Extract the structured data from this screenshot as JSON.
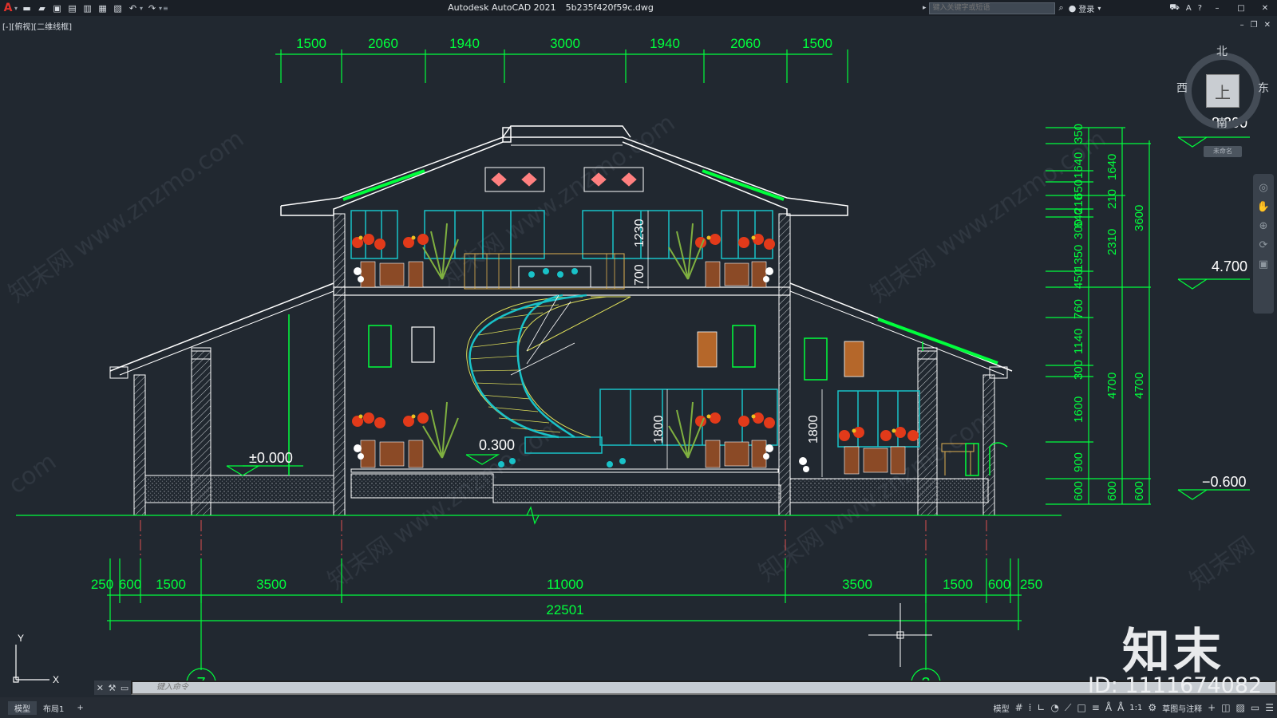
{
  "app": {
    "title": "Autodesk AutoCAD 2021",
    "filename": "5b235f420f59c.dwg",
    "search_placeholder": "键入关键字或短语",
    "login_label": "登录"
  },
  "viewport": {
    "label": "[-][俯视][二维线框]"
  },
  "viewcube": {
    "north": "北",
    "south": "南",
    "east": "东",
    "west": "西",
    "face": "上",
    "unnamed": "未命名"
  },
  "dims": {
    "top": [
      "1500",
      "2060",
      "1940",
      "3000",
      "1940",
      "2060",
      "1500"
    ],
    "bottom": [
      "250",
      "600",
      "1500",
      "3500",
      "11000",
      "3500",
      "1500",
      "600",
      "250"
    ],
    "total": "22501",
    "right_inner": [
      "350",
      "1640",
      "650",
      "210",
      "640",
      "300",
      "1350",
      "450",
      "760",
      "1140",
      "300",
      "1600",
      "900",
      "600"
    ],
    "right_mid": [
      "1640",
      "210",
      "2310",
      "4700",
      "600"
    ],
    "right_outer": [
      "3600",
      "4700",
      "600"
    ],
    "levels": [
      "8.300",
      "4.700",
      "−0.600"
    ],
    "floor_labels": [
      "±0.000",
      "0.300"
    ],
    "vertical_labels": [
      "1230",
      "700",
      "1800",
      "1800"
    ]
  },
  "axes": {
    "left_bubble": "7",
    "right_bubble": "3"
  },
  "ucs": {
    "x": "X",
    "y": "Y"
  },
  "command": {
    "placeholder": "键入命令"
  },
  "status": {
    "tabs": [
      "模型",
      "布局1"
    ],
    "model_label": "模型",
    "scale": "1:1",
    "workspace": "草图与注释"
  },
  "watermark": {
    "logo": "知末",
    "id": "ID: 1111674082"
  },
  "colors": {
    "bg": "#212830",
    "dim": "#00ff3c",
    "wall": "#ffffff",
    "glass": "#19c2c8",
    "stair": "#e0e05a",
    "flower": "#e23a1a"
  }
}
